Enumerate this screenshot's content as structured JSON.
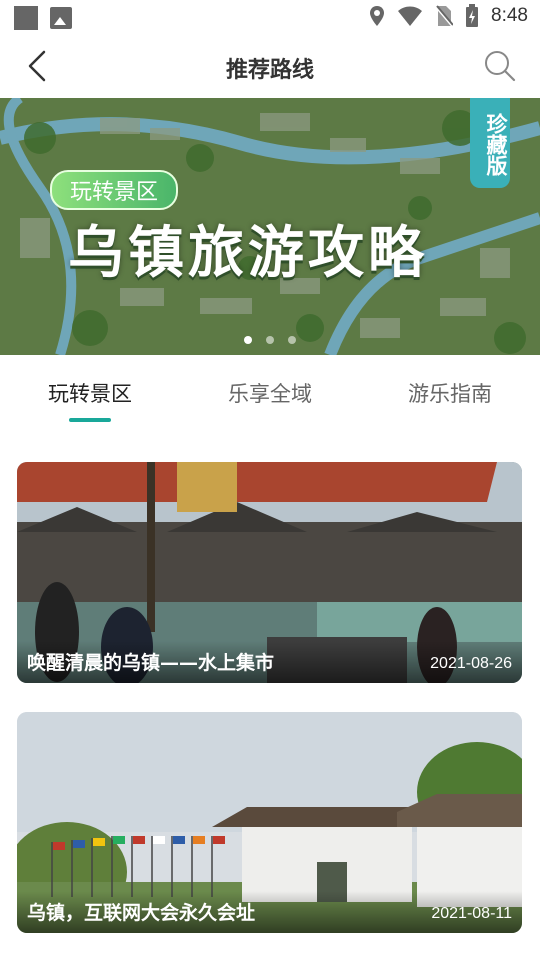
{
  "status_bar": {
    "time": "8:48"
  },
  "header": {
    "title": "推荐路线"
  },
  "banner": {
    "badge": "玩转景区",
    "title": "乌镇旅游攻略",
    "corner_label": "珍藏版",
    "slides": 3,
    "active_slide": 1
  },
  "tabs": [
    {
      "label": "玩转景区",
      "active": true
    },
    {
      "label": "乐享全域",
      "active": false
    },
    {
      "label": "游乐指南",
      "active": false
    }
  ],
  "cards": [
    {
      "title": "唤醒清晨的乌镇——水上集市",
      "date": "2021-08-26"
    },
    {
      "title": "乌镇，互联网大会永久会址",
      "date": "2021-08-11"
    }
  ],
  "colors": {
    "accent": "#19a89a",
    "text": "#333333",
    "muted": "#666666"
  }
}
